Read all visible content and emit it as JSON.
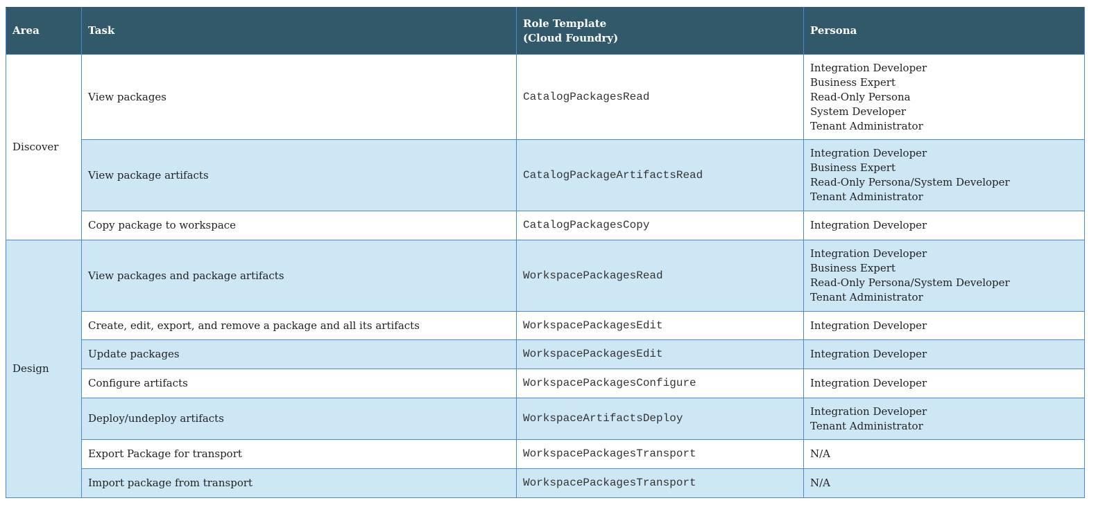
{
  "header": {
    "area": "Area",
    "task": "Task",
    "role_template_line1": "Role Template",
    "role_template_line2": "(Cloud Foundry)",
    "persona": "Persona"
  },
  "groups": [
    {
      "area": "Discover",
      "rows": [
        {
          "task": "View packages",
          "role": "CatalogPackagesRead",
          "personas": [
            "Integration Developer",
            "Business Expert",
            "Read-Only Persona",
            "System Developer",
            "Tenant Administrator"
          ]
        },
        {
          "task": "View package artifacts",
          "role": "CatalogPackageArtifactsRead",
          "personas": [
            "Integration Developer",
            "Business Expert",
            "Read-Only Persona/System Developer",
            "Tenant Administrator"
          ]
        },
        {
          "task": "Copy package to workspace",
          "role": "CatalogPackagesCopy",
          "personas": [
            "Integration Developer"
          ]
        }
      ]
    },
    {
      "area": "Design",
      "rows": [
        {
          "task": "View packages and package artifacts",
          "role": "WorkspacePackagesRead",
          "personas": [
            "Integration Developer",
            "Business Expert",
            "Read-Only Persona/System Developer",
            "Tenant Administrator"
          ]
        },
        {
          "task": "Create, edit, export, and remove a package and all its artifacts",
          "role": "WorkspacePackagesEdit",
          "personas": [
            "Integration Developer"
          ]
        },
        {
          "task": "Update packages",
          "role": "WorkspacePackagesEdit",
          "personas": [
            "Integration Developer"
          ]
        },
        {
          "task": "Configure artifacts",
          "role": "WorkspacePackagesConfigure",
          "personas": [
            "Integration Developer"
          ]
        },
        {
          "task": "Deploy/undeploy artifacts",
          "role": "WorkspaceArtifactsDeploy",
          "personas": [
            "Integration Developer",
            "Tenant Administrator"
          ]
        },
        {
          "task": "Export Package for transport",
          "role": "WorkspacePackagesTransport",
          "personas": [
            "N/A"
          ]
        },
        {
          "task": "Import package from transport",
          "role": "WorkspacePackagesTransport",
          "personas": [
            "N/A"
          ]
        }
      ]
    }
  ]
}
